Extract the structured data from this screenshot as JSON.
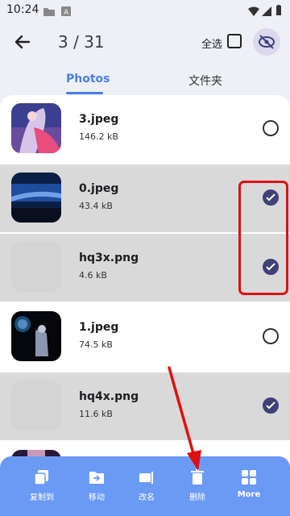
{
  "status_bar": {
    "time": "10:24",
    "icons": [
      "folder-icon",
      "a-icon",
      "wifi-icon",
      "signal-icon",
      "battery-icon"
    ]
  },
  "header": {
    "title": "3 / 31",
    "select_all_label": "全选",
    "icons": [
      "back-arrow-icon",
      "checkbox-icon",
      "eye-off-icon"
    ]
  },
  "tabs": [
    {
      "label": "Photos",
      "active": true
    },
    {
      "label": "文件夹",
      "active": false
    }
  ],
  "files": [
    {
      "name": "3.jpeg",
      "size": "146.2 kB",
      "selected": false
    },
    {
      "name": "0.jpeg",
      "size": "43.4 kB",
      "selected": true
    },
    {
      "name": "hq3x.png",
      "size": "4.6 kB",
      "selected": true
    },
    {
      "name": "1.jpeg",
      "size": "74.5 kB",
      "selected": false
    },
    {
      "name": "hq4x.png",
      "size": "11.6 kB",
      "selected": true
    }
  ],
  "bottom_actions": [
    {
      "label": "复制到",
      "icon": "copy-icon"
    },
    {
      "label": "移动",
      "icon": "move-folder-icon"
    },
    {
      "label": "改名",
      "icon": "rename-icon"
    },
    {
      "label": "删除",
      "icon": "delete-icon"
    },
    {
      "label": "More",
      "icon": "grid-icon"
    }
  ],
  "colors": {
    "accent": "#4a7ee8",
    "bottom_bar": "#6b9af5",
    "selected_row": "#d9d9d9",
    "check": "#3f4177",
    "annotation": "#e01010"
  }
}
